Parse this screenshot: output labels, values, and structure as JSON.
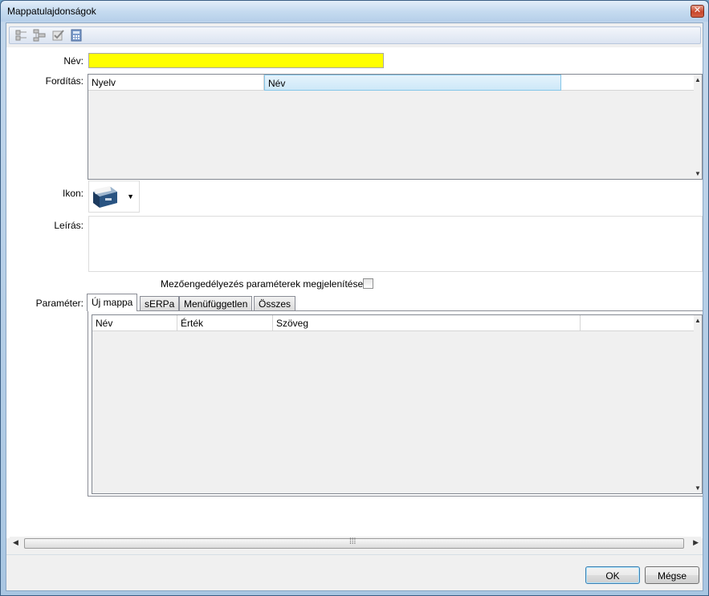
{
  "window": {
    "title": "Mappatulajdonságok",
    "close_glyph": "✕"
  },
  "toolbar": {
    "icons": [
      "tree-collapse-icon",
      "tree-expand-icon",
      "edit-check-icon",
      "calculator-icon"
    ]
  },
  "form": {
    "name_label": "Név:",
    "name_value": "",
    "translation_label": "Fordítás:",
    "translation_columns": [
      "Nyelv",
      "Név"
    ],
    "icon_label": "Ikon:",
    "icon_value": "folder-cabinet-icon",
    "description_label": "Leírás:",
    "description_value": "",
    "field_permission_label": "Mezőengedélyezés paraméterek megjelenítése:",
    "field_permission_checked": false,
    "parameter_label": "Paraméter:",
    "tabs": [
      "Új mappa",
      "sERPa",
      "Menüfüggetlen",
      "Összes"
    ],
    "active_tab": "Új mappa",
    "param_columns": [
      "Név",
      "Érték",
      "Szöveg"
    ]
  },
  "buttons": {
    "ok": "OK",
    "cancel": "Mégse"
  },
  "colors": {
    "name_field": "#ffff00",
    "header_highlight": "#cde8f8"
  }
}
